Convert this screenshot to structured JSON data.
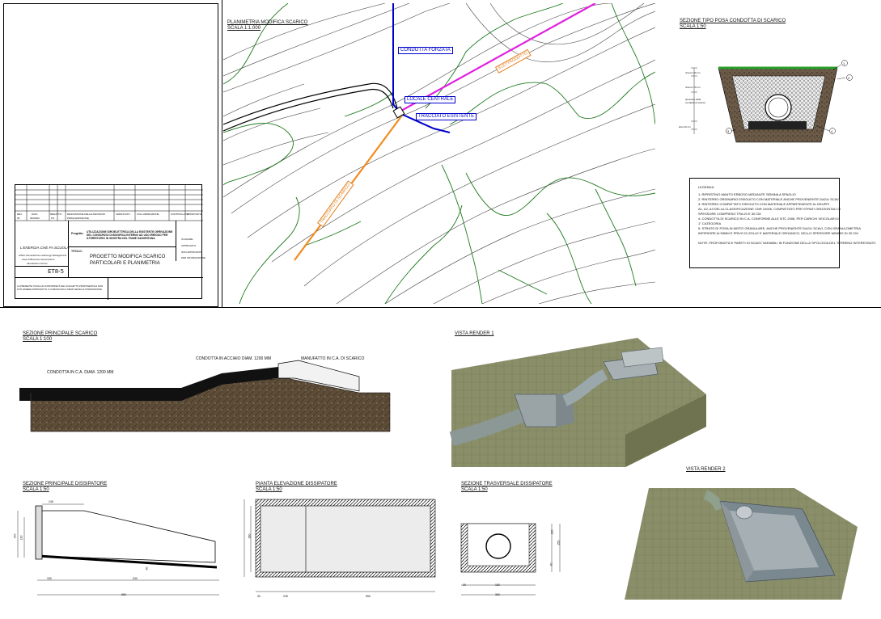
{
  "plan": {
    "title": "PLANIMETRIA MODIFICA SCARICO",
    "scale": "SCALA 1:1.000",
    "labels": {
      "condotta_forzata": "CONDOTTA FORZATA",
      "locale_centrale": "LOCALE CENTRALE",
      "tracciato_esistente": "TRACCIATO ESISTENTE",
      "elettrodotto": "ELETTRODOTTO",
      "tracciato_scarico": "TRACCIATO DI SCARICO"
    }
  },
  "section_tipo": {
    "title": "SEZIONE TIPO POSA CONDOTTA DI SCARICO",
    "scale": "SCALA 1:50",
    "dims": [
      "rinterro 20 cm",
      "rinterro 70 cm",
      "spessore della condotta di scarico",
      "letto 20 cm"
    ],
    "callouts": [
      "1",
      "2",
      "3",
      "4",
      "5"
    ]
  },
  "legend": {
    "title": "LEGENDA:",
    "items": [
      "1: RIPRISTINO MANTO ERBOSO MEDIANTE SEMINA A SPAGLIO",
      "2: RINTERRO ORDINARIO ESEGUITO CON MATERIALE ANCHE PROVENIENTE DAGLI SCAVI",
      "3: RINTERRO COMPATTATO ESEGUITO CON MATERIALE APPARTENENTE AI GRUPPI",
      "   A1, A2, A3 DELLA CLASSIFICAZIONE CNR 10006, COMPATTATO PER STRATI ORIZZONTALI DI",
      "   SPESSORE COMPRESO TRA 20 E 30 CM",
      "4: CONDOTTA DI SCARICO IN C.A. CONFORME ALLE NTC 2008, PER CARICHI VEICOLARI DI",
      "   1° CATEGORIA",
      "5: STRATO DI POSA IN MISTO GRANULARE, ANCHE PROVENIENTE DAGLI SCAVI, CON GRANULOMETRIA",
      "   INFERIORE AI 50MM E PRIVO DI ZOLLE E MATERIALE ORGANICO, DELLO SPESSORE MINIMO DI 20 CM"
    ],
    "note": "NOTE: PROFONDITÀ E PARETI DI SCAVO VARIABILI IN FUNZIONE DELLA TIPOLOGIA DEL TERRENO INTERESSATO"
  },
  "title_block": {
    "company": "L'ENERGIA CHE FA SCUOLA",
    "company_sub": [
      "Ufficio Generazione ed Energy Management",
      "Area di Business Generazione",
      "Idroelettrico Centro"
    ],
    "project_label": "Progetto:",
    "project_text": "UTILIZZAZIONE IDROELETTRICA DELLA ESISTENTE DERIVAZIONE DEL CONSORZIO DI BONIFICA INTERNO AD USO IRRIGUO PER ILTERRITORIO IN SINISTRA DEL FIUME SANGRITANA",
    "title_label": "TITOLO:",
    "title_line1": "PROGETTO MODIFICA SCARICO",
    "title_line2": "PARTICOLARI E PLANIMETRIA",
    "code": "ET8-5",
    "rev_headers": [
      "REV.",
      "DATA",
      "REDATTO",
      "DESCRIZIONE DELLE REVISIONI",
      "VERIFICATO",
      "COLLABORAZIONE",
      "CONTROLLATO",
      "APPROVATO"
    ],
    "rev_row": [
      "00",
      "00/00/00",
      "PO",
      "PRIMA EMISSIONE",
      "",
      "",
      "",
      ""
    ],
    "options": [
      "IN ESAME",
      "APPROVATO",
      "NON APPROVATO",
      "PER INFORMAZIONE"
    ],
    "footer_note": "LA PRESENTE TAVOLA È DI PROPRIETÀ DEL SOGGETTO PROPONENTE E NON PUÒ ESSERE RIPRODOTTA O COMUNICATA A TERZI SENZA AUTORIZZAZIONE"
  },
  "section_main": {
    "title": "SEZIONE PRINCIPALE SCARICO",
    "scale": "SCALA 1:100",
    "label_ca": "CONDOTTA IN C.A. DIAM. 1200 MM",
    "label_acciaio": "CONDOTTA IN ACCIAIO DIAM. 1200 MM",
    "label_manufatto": "MANUFATTO IN C.A. DI SCARICO"
  },
  "render1": {
    "title": "VISTA RENDER 1"
  },
  "render2": {
    "title": "VISTA RENDER 2"
  },
  "dissipatore_sezione": {
    "title": "SEZIONE PRINCIPALE DISSIPATORE",
    "scale": "SCALA 1:50",
    "dims": [
      "245",
      "140",
      "120",
      "30",
      "330",
      "540",
      "650"
    ]
  },
  "dissipatore_pianta": {
    "title": "PIANTA ELEVAZIONE DISSIPATORE",
    "scale": "SCALA 1:50",
    "dims": [
      "30",
      "225",
      "550",
      "360"
    ]
  },
  "dissipatore_trasv": {
    "title": "SEZIONE TRASVERSALE DISSIPATORE",
    "scale": "SCALA 1:50",
    "dims": [
      "30",
      "180",
      "360",
      "250",
      "120",
      "30"
    ]
  }
}
